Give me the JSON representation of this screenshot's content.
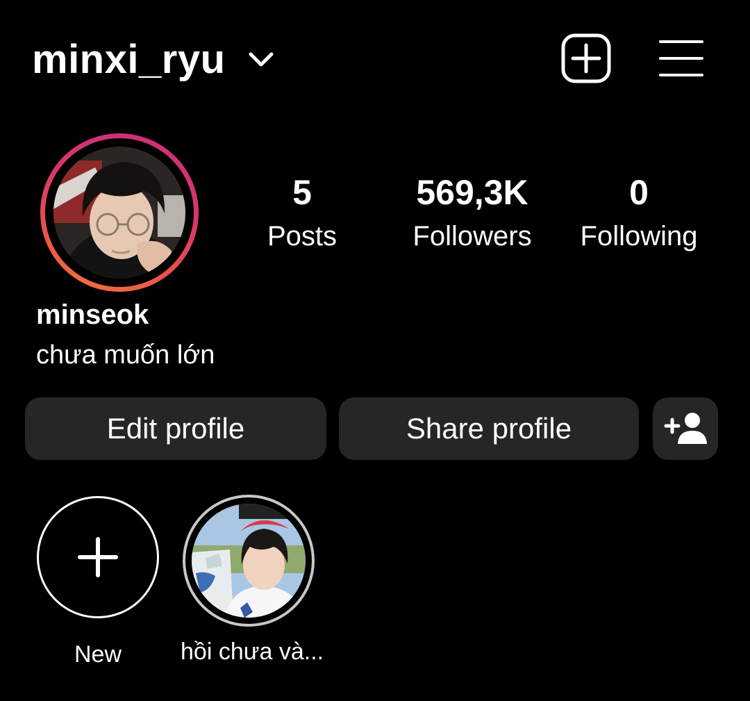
{
  "header": {
    "username": "minxi_ryu",
    "switch_icon": "chevron-down-icon",
    "create_icon": "plus-square-icon",
    "menu_icon": "hamburger-menu-icon"
  },
  "profile": {
    "avatar_icon": "profile-photo",
    "stats": [
      {
        "value": "5",
        "label": "Posts"
      },
      {
        "value": "569,3K",
        "label": "Followers"
      },
      {
        "value": "0",
        "label": "Following"
      }
    ],
    "display_name": "minseok",
    "bio": "chưa muốn lớn"
  },
  "actions": {
    "edit_label": "Edit profile",
    "share_label": "Share profile",
    "discover_icon": "add-person-icon"
  },
  "highlights": [
    {
      "label": "New",
      "icon": "plus-icon"
    },
    {
      "label": "hồi chưa và..."
    }
  ],
  "colors": {
    "background": "#000000",
    "button": "#262626",
    "text": "#ffffff",
    "story_ring_start": "#c82f7c",
    "story_ring_end": "#f47a35",
    "highlight_ring": "#c8c8c8"
  }
}
